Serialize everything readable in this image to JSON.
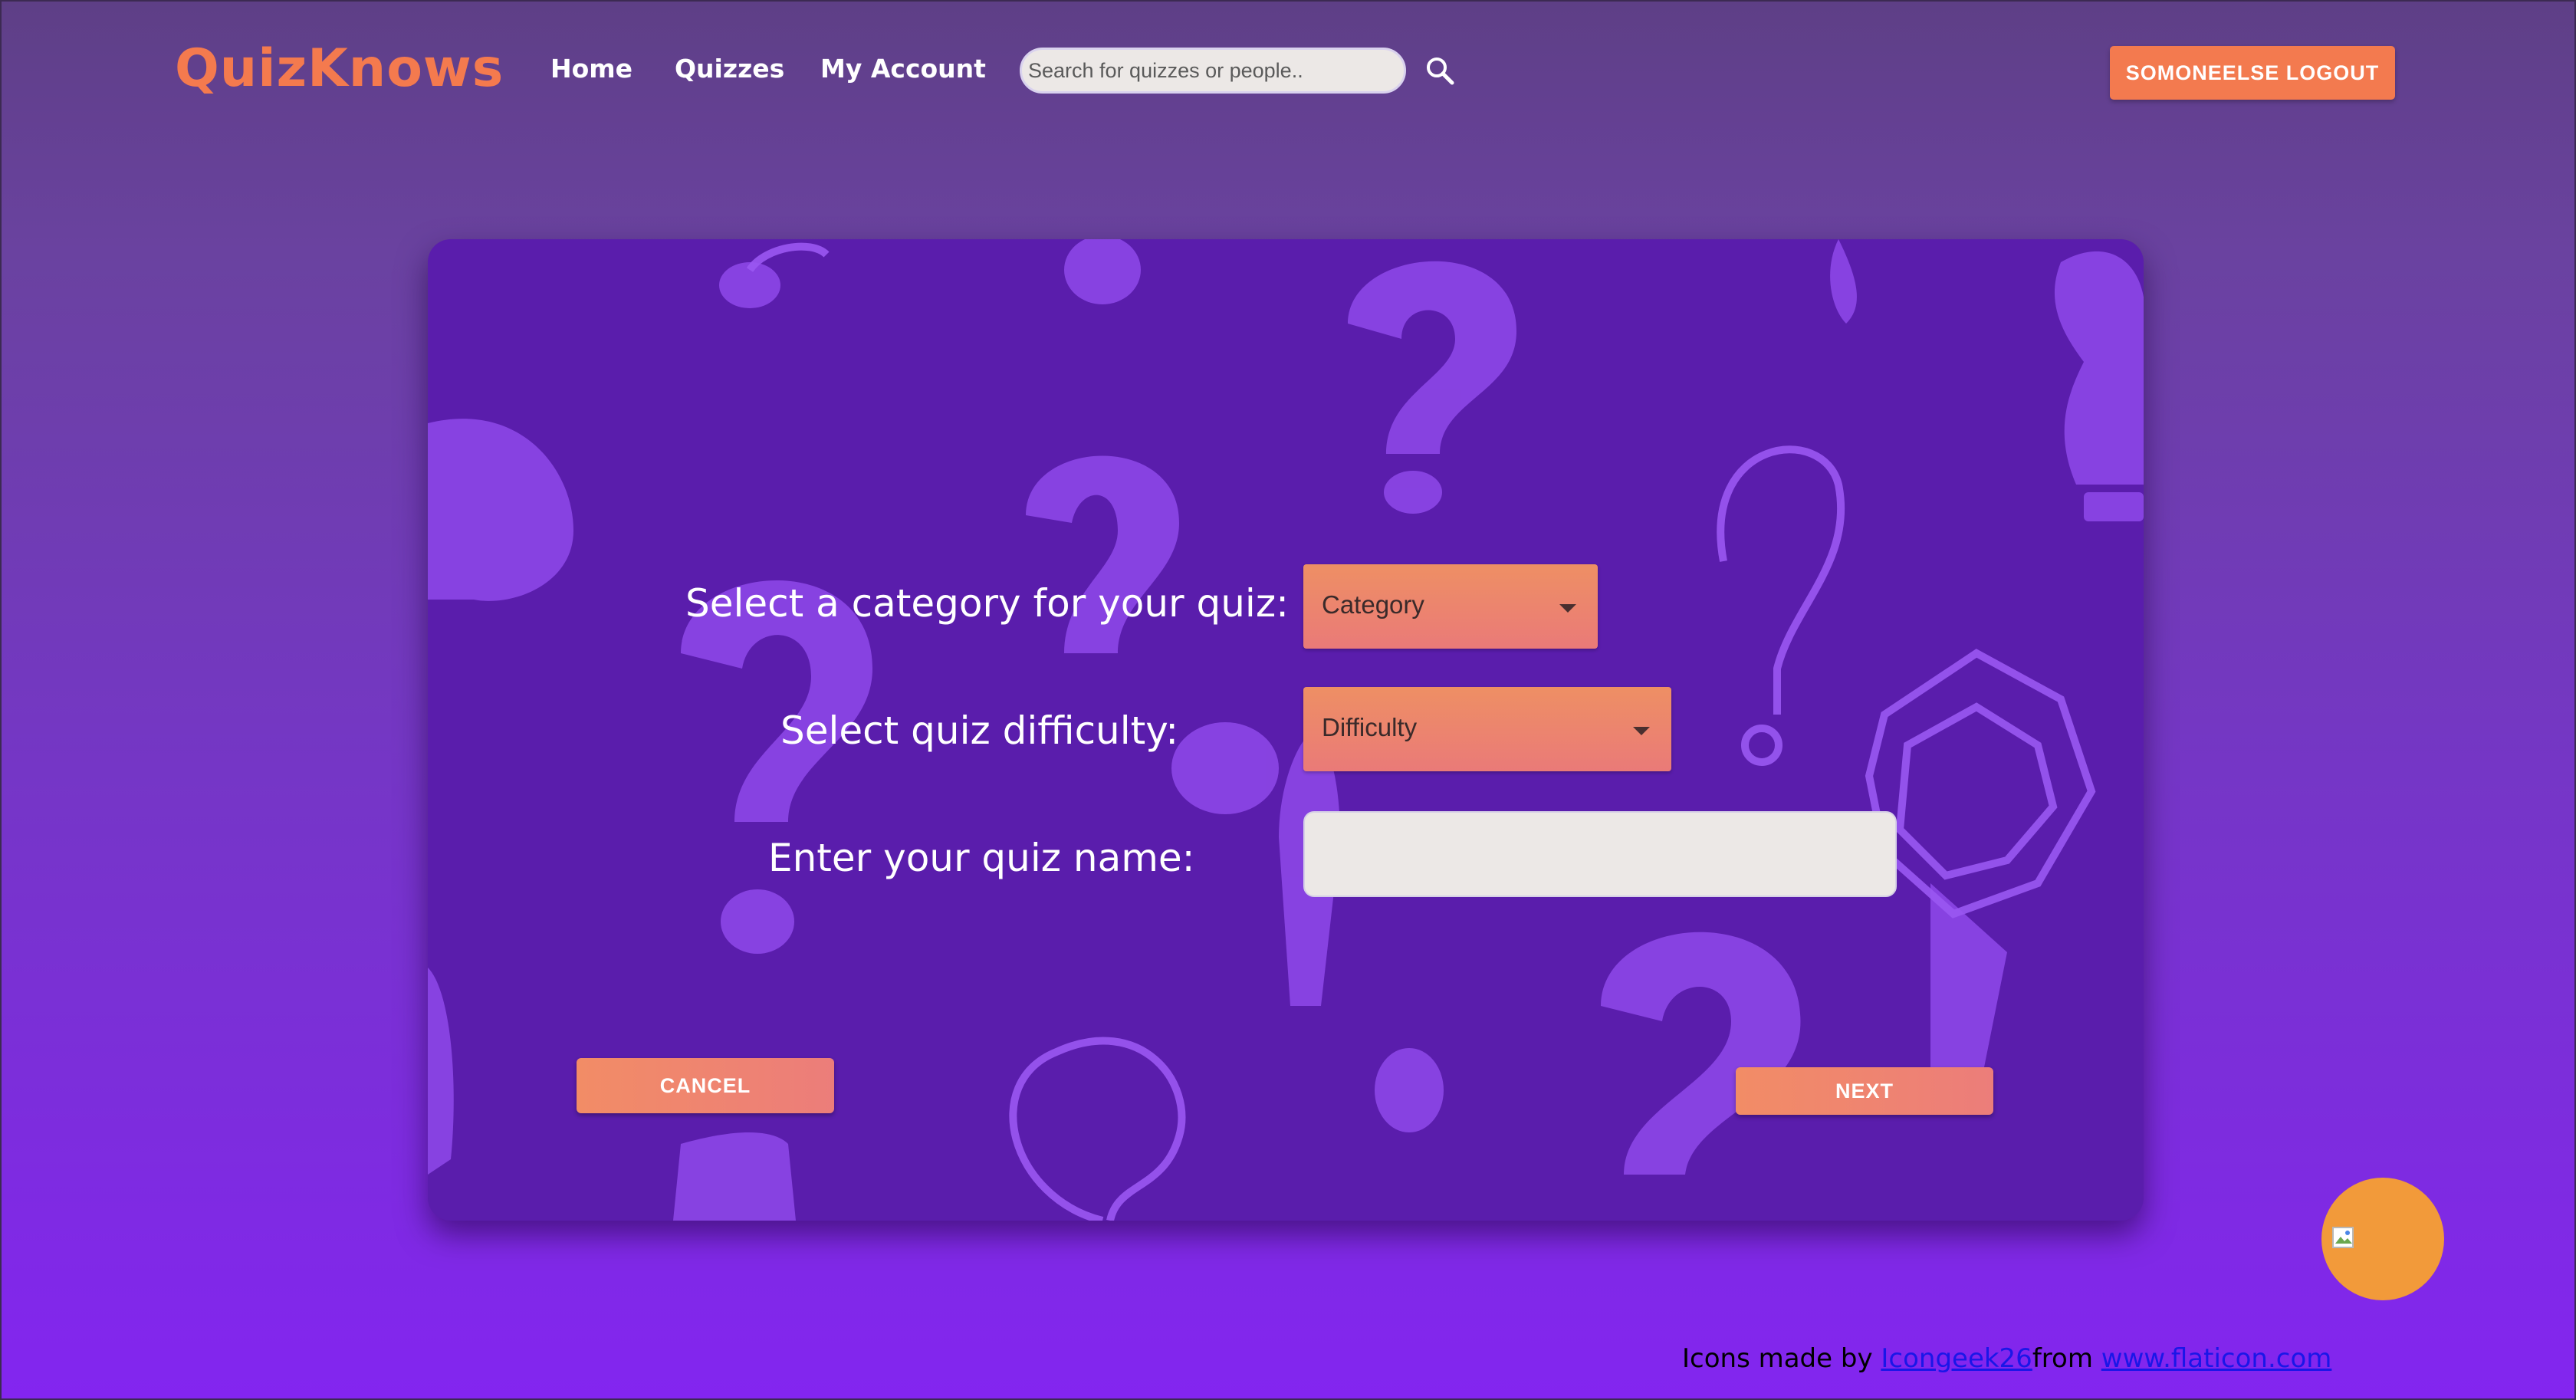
{
  "header": {
    "logo": "QuizKnows",
    "nav": {
      "home": "Home",
      "quizzes": "Quizzes",
      "my_account": "My Account"
    },
    "search": {
      "placeholder": "Search for quizzes or people..",
      "value": "",
      "icon": "search-icon"
    },
    "logout_label": "SOMONEELSE LOGOUT"
  },
  "form": {
    "category_label": "Select a category for your quiz:",
    "category_value": "Category",
    "difficulty_label": "Select quiz difficulty:",
    "difficulty_value": "Difficulty",
    "name_label": "Enter your quiz name:",
    "name_value": "",
    "cancel_label": "CANCEL",
    "next_label": "NEXT"
  },
  "fab": {
    "icon": "broken-image-icon"
  },
  "footer": {
    "prefix": "Icons made by ",
    "author": "Icongeek26",
    "middle": "from ",
    "site": "www.flaticon.com"
  },
  "colors": {
    "accent": "#f47a4e",
    "card_bg": "#5a1dac",
    "pattern": "#9b55f0",
    "page_top": "#5e3f86",
    "page_bottom": "#8325f0",
    "fab": "#f29a3a",
    "link": "#1a16e8"
  }
}
